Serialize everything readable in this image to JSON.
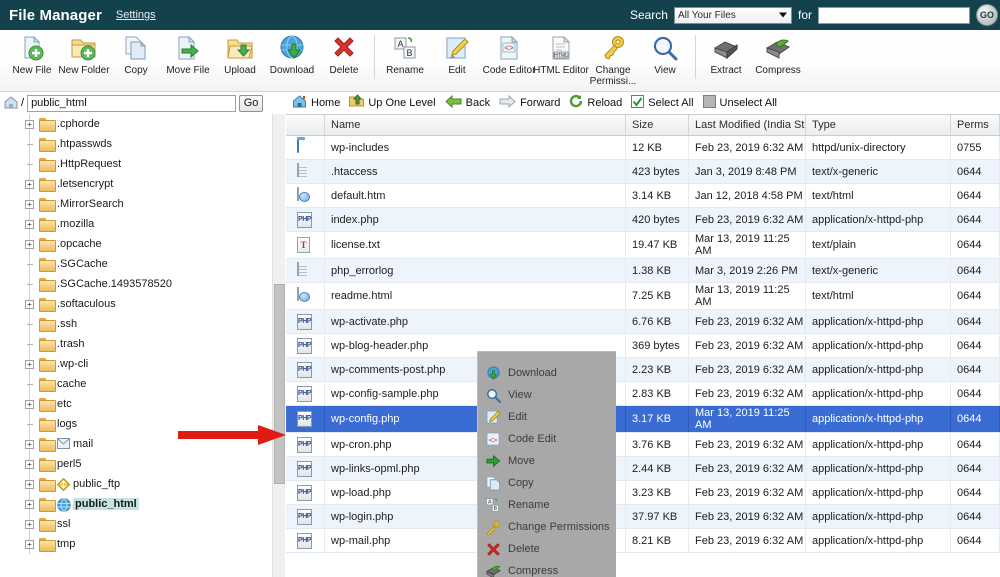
{
  "app": {
    "title": "File Manager",
    "settings_label": "Settings"
  },
  "search": {
    "label": "Search",
    "scope_selected": "All Your Files",
    "scope_options": [
      "All Your Files"
    ],
    "for_label": "for",
    "query": "",
    "go_label": "GO"
  },
  "toolbar": {
    "items": [
      {
        "label": "New File",
        "icon": "new-file-icon"
      },
      {
        "label": "New Folder",
        "icon": "new-folder-icon"
      },
      {
        "label": "Copy",
        "icon": "copy-icon"
      },
      {
        "label": "Move File",
        "icon": "move-file-icon"
      },
      {
        "label": "Upload",
        "icon": "upload-icon"
      },
      {
        "label": "Download",
        "icon": "download-icon"
      },
      {
        "label": "Delete",
        "icon": "delete-icon"
      },
      {
        "label": "Rename",
        "icon": "rename-icon"
      },
      {
        "label": "Edit",
        "icon": "edit-icon"
      },
      {
        "label": "Code Editor",
        "icon": "code-editor-icon"
      },
      {
        "label": "HTML Editor",
        "icon": "html-editor-icon"
      },
      {
        "label": "Change Permissi...",
        "icon": "change-permissions-icon"
      },
      {
        "label": "View",
        "icon": "view-icon"
      },
      {
        "label": "Extract",
        "icon": "extract-icon"
      },
      {
        "label": "Compress",
        "icon": "compress-icon"
      }
    ]
  },
  "pathbar": {
    "value": "public_html",
    "prefix": "/",
    "go_label": "Go"
  },
  "tree": {
    "items": [
      {
        "label": ".cphorde",
        "expandable": true,
        "selected": false,
        "icon": "folder-icon"
      },
      {
        "label": ".htpasswds",
        "expandable": false,
        "selected": false,
        "icon": "folder-icon"
      },
      {
        "label": ".HttpRequest",
        "expandable": false,
        "selected": false,
        "icon": "folder-icon"
      },
      {
        "label": ".letsencrypt",
        "expandable": true,
        "selected": false,
        "icon": "folder-icon"
      },
      {
        "label": ".MirrorSearch",
        "expandable": true,
        "selected": false,
        "icon": "folder-icon"
      },
      {
        "label": ".mozilla",
        "expandable": true,
        "selected": false,
        "icon": "folder-icon"
      },
      {
        "label": ".opcache",
        "expandable": true,
        "selected": false,
        "icon": "folder-icon"
      },
      {
        "label": ".SGCache",
        "expandable": false,
        "selected": false,
        "icon": "folder-icon"
      },
      {
        "label": ".SGCache.1493578520",
        "expandable": false,
        "selected": false,
        "icon": "folder-icon"
      },
      {
        "label": ".softaculous",
        "expandable": true,
        "selected": false,
        "icon": "folder-icon"
      },
      {
        "label": ".ssh",
        "expandable": false,
        "selected": false,
        "icon": "folder-icon"
      },
      {
        "label": ".trash",
        "expandable": false,
        "selected": false,
        "icon": "folder-icon"
      },
      {
        "label": ".wp-cli",
        "expandable": true,
        "selected": false,
        "icon": "folder-icon"
      },
      {
        "label": "cache",
        "expandable": false,
        "selected": false,
        "icon": "folder-icon"
      },
      {
        "label": "etc",
        "expandable": true,
        "selected": false,
        "icon": "folder-icon"
      },
      {
        "label": "logs",
        "expandable": false,
        "selected": false,
        "icon": "folder-icon"
      },
      {
        "label": "mail",
        "expandable": true,
        "selected": false,
        "icon": "folder-mail-icon"
      },
      {
        "label": "perl5",
        "expandable": true,
        "selected": false,
        "icon": "folder-icon"
      },
      {
        "label": "public_ftp",
        "expandable": true,
        "selected": false,
        "icon": "folder-ftp-icon"
      },
      {
        "label": "public_html",
        "expandable": true,
        "selected": true,
        "icon": "folder-globe-icon"
      },
      {
        "label": "ssl",
        "expandable": true,
        "selected": false,
        "icon": "folder-icon"
      },
      {
        "label": "tmp",
        "expandable": true,
        "selected": false,
        "icon": "folder-icon"
      }
    ]
  },
  "navbar": {
    "items": [
      {
        "label": "Home",
        "icon": "home-icon"
      },
      {
        "label": "Up One Level",
        "icon": "up-one-level-icon"
      },
      {
        "label": "Back",
        "icon": "back-arrow-icon"
      },
      {
        "label": "Forward",
        "icon": "forward-arrow-icon"
      },
      {
        "label": "Reload",
        "icon": "reload-icon"
      },
      {
        "label": "Select All",
        "icon": "checkbox-checked-icon"
      },
      {
        "label": "Unselect All",
        "icon": "checkbox-empty-icon"
      }
    ]
  },
  "filegrid": {
    "columns": [
      "",
      "Name",
      "Size",
      "Last Modified (India Star",
      "Type",
      "Perms"
    ],
    "rows": [
      {
        "icon": "folder-blue-icon",
        "name": "wp-includes",
        "size": "12 KB",
        "modified": "Feb 23, 2019 6:32 AM",
        "type": "httpd/unix-directory",
        "perms": "0755",
        "selected": false
      },
      {
        "icon": "text-file-icon",
        "name": ".htaccess",
        "size": "423 bytes",
        "modified": "Jan 3, 2019 8:48 PM",
        "type": "text/x-generic",
        "perms": "0644",
        "selected": false
      },
      {
        "icon": "html-file-icon",
        "name": "default.htm",
        "size": "3.14 KB",
        "modified": "Jan 12, 2018 4:58 PM",
        "type": "text/html",
        "perms": "0644",
        "selected": false
      },
      {
        "icon": "php-file-icon",
        "name": "index.php",
        "size": "420 bytes",
        "modified": "Feb 23, 2019 6:32 AM",
        "type": "application/x-httpd-php",
        "perms": "0644",
        "selected": false
      },
      {
        "icon": "txt-file-icon",
        "name": "license.txt",
        "size": "19.47 KB",
        "modified": "Mar 13, 2019 11:25 AM",
        "type": "text/plain",
        "perms": "0644",
        "selected": false
      },
      {
        "icon": "text-file-icon",
        "name": "php_errorlog",
        "size": "1.38 KB",
        "modified": "Mar 3, 2019 2:26 PM",
        "type": "text/x-generic",
        "perms": "0644",
        "selected": false
      },
      {
        "icon": "html-file-icon",
        "name": "readme.html",
        "size": "7.25 KB",
        "modified": "Mar 13, 2019 11:25 AM",
        "type": "text/html",
        "perms": "0644",
        "selected": false
      },
      {
        "icon": "php-file-icon",
        "name": "wp-activate.php",
        "size": "6.76 KB",
        "modified": "Feb 23, 2019 6:32 AM",
        "type": "application/x-httpd-php",
        "perms": "0644",
        "selected": false
      },
      {
        "icon": "php-file-icon",
        "name": "wp-blog-header.php",
        "size": "369 bytes",
        "modified": "Feb 23, 2019 6:32 AM",
        "type": "application/x-httpd-php",
        "perms": "0644",
        "selected": false
      },
      {
        "icon": "php-file-icon",
        "name": "wp-comments-post.php",
        "size": "2.23 KB",
        "modified": "Feb 23, 2019 6:32 AM",
        "type": "application/x-httpd-php",
        "perms": "0644",
        "selected": false
      },
      {
        "icon": "php-file-icon",
        "name": "wp-config-sample.php",
        "size": "2.83 KB",
        "modified": "Feb 23, 2019 6:32 AM",
        "type": "application/x-httpd-php",
        "perms": "0644",
        "selected": false
      },
      {
        "icon": "php-file-icon",
        "name": "wp-config.php",
        "size": "3.17 KB",
        "modified": "Mar 13, 2019 11:25 AM",
        "type": "application/x-httpd-php",
        "perms": "0644",
        "selected": true
      },
      {
        "icon": "php-file-icon",
        "name": "wp-cron.php",
        "size": "3.76 KB",
        "modified": "Feb 23, 2019 6:32 AM",
        "type": "application/x-httpd-php",
        "perms": "0644",
        "selected": false
      },
      {
        "icon": "php-file-icon",
        "name": "wp-links-opml.php",
        "size": "2.44 KB",
        "modified": "Feb 23, 2019 6:32 AM",
        "type": "application/x-httpd-php",
        "perms": "0644",
        "selected": false
      },
      {
        "icon": "php-file-icon",
        "name": "wp-load.php",
        "size": "3.23 KB",
        "modified": "Feb 23, 2019 6:32 AM",
        "type": "application/x-httpd-php",
        "perms": "0644",
        "selected": false
      },
      {
        "icon": "php-file-icon",
        "name": "wp-login.php",
        "size": "37.97 KB",
        "modified": "Feb 23, 2019 6:32 AM",
        "type": "application/x-httpd-php",
        "perms": "0644",
        "selected": false
      },
      {
        "icon": "php-file-icon",
        "name": "wp-mail.php",
        "size": "8.21 KB",
        "modified": "Feb 23, 2019 6:32 AM",
        "type": "application/x-httpd-php",
        "perms": "0644",
        "selected": false
      }
    ]
  },
  "context_menu": {
    "items": [
      {
        "label": "Download",
        "icon": "download-icon"
      },
      {
        "label": "View",
        "icon": "magnifier-icon"
      },
      {
        "label": "Edit",
        "icon": "pencil-icon"
      },
      {
        "label": "Code Edit",
        "icon": "code-icon"
      },
      {
        "label": "Move",
        "icon": "move-arrow-icon"
      },
      {
        "label": "Copy",
        "icon": "copy-icon"
      },
      {
        "label": "Rename",
        "icon": "rename-icon"
      },
      {
        "label": "Change Permissions",
        "icon": "key-icon"
      },
      {
        "label": "Delete",
        "icon": "red-x-icon"
      },
      {
        "label": "Compress",
        "icon": "compress-icon"
      }
    ]
  },
  "annotation": {
    "arrow": "red-arrow-pointing-right"
  },
  "colors": {
    "header_bg": "#14424c",
    "selection_blue": "#3b6cd4",
    "row_alt": "#eef4fb",
    "menu_gray": "#a8a8a8",
    "arrow_red": "#e01b14",
    "tree_highlight": "#c6e3e3"
  }
}
